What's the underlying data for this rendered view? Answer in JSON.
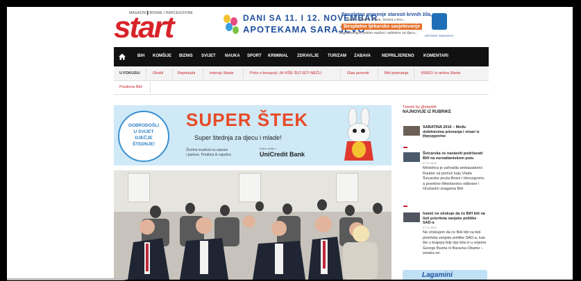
{
  "header": {
    "logo_tagline": "MAGAZIN ▌BOSNE I HERCEGOVINE",
    "logo_text": "start"
  },
  "top_ad": {
    "line1": "DANI SA 11. I 12. NOVEMBAR",
    "line2": "APOTEKAMA SARAJEVO",
    "right1": "Besplatno mjerenje starosti krvnih žila,",
    "right2": "visine i tjelesne težine, šećera u krvi...",
    "right3": "Besplatno ljekarsko savjetovanje",
    "right4": "Nagradna igra, poklon vaučeri, radionice za djecu...",
    "pharmacy": "APOTEKE SARAJEVO"
  },
  "nav": {
    "items": [
      "BiH",
      "KOMŠIJE",
      "BIZNIS",
      "SVIJET",
      "NAUKA",
      "SPORT",
      "KRIMINAL",
      "ZDRAVLJE",
      "TURIZAM",
      "ZABAVA",
      "NEPRILJERENO",
      "KOMENTARI"
    ]
  },
  "focus": {
    "label": "U FOKUSU:",
    "links": [
      "Okoliš",
      "Reportaža",
      "Intervju Starta",
      "Priče o korupciji: JA VIŠE ŠUTJETI NEĆU",
      "Glas javnosti",
      "BiH potovanja",
      "VIDEO: Iz arhiva Starta"
    ],
    "links2": [
      "Pozitivna BiH"
    ]
  },
  "banner": {
    "circle_lines": [
      "DOBRODOŠLI",
      "U SVIJET",
      "DJEČJE",
      "ŠTEDNJE!"
    ],
    "title": "SUPER ŠTEK",
    "subtitle": "Super štednja za djecu i mlade!",
    "fine1": "Životna mudrost su uspone",
    "fine2": "i padove. Predima ih zajedno.",
    "bank_small": "Dobro došli u",
    "bank": "UniCredit Bank"
  },
  "sidebar": {
    "tweets": "Tweets by @startbh",
    "heading": "NAJNOVIJE IZ RUBRIKE",
    "articles": [
      {
        "title": "SABATINA 2016 – Među dobitnicima priznanja i vinari iz Hercegovine",
        "date": "07.11.2016",
        "body": ""
      },
      {
        "title": "Švicarska će nastaviti podržavati BiH na euroatlantskom putu",
        "date": "07.11.2016",
        "body": "Ministrica je zahvalila ambasadorici Rauber za pomoć koju Vlada Švicarske pruža Bosni i Hercegovini, a posebno Ministarstvu odbrane i Oružanim snagama BiH"
      },
      {
        "title": "Ivanić ne očekuje da će BiH biti na listi prioriteta vanjske politike SAD-a",
        "date": "07.11.2016",
        "body": "Ne očekujem da će BiH biti na listi prioriteta vanjske politike SAD-a, kao što u krajnjoj liniji nije bila ni u vrijeme George Busha ni Baracka Obame – smatra on."
      }
    ],
    "ad_text": "Lagamini"
  },
  "colors": {
    "accent": "#d8232a",
    "nav_bg": "#111111",
    "link": "#c8202a"
  }
}
